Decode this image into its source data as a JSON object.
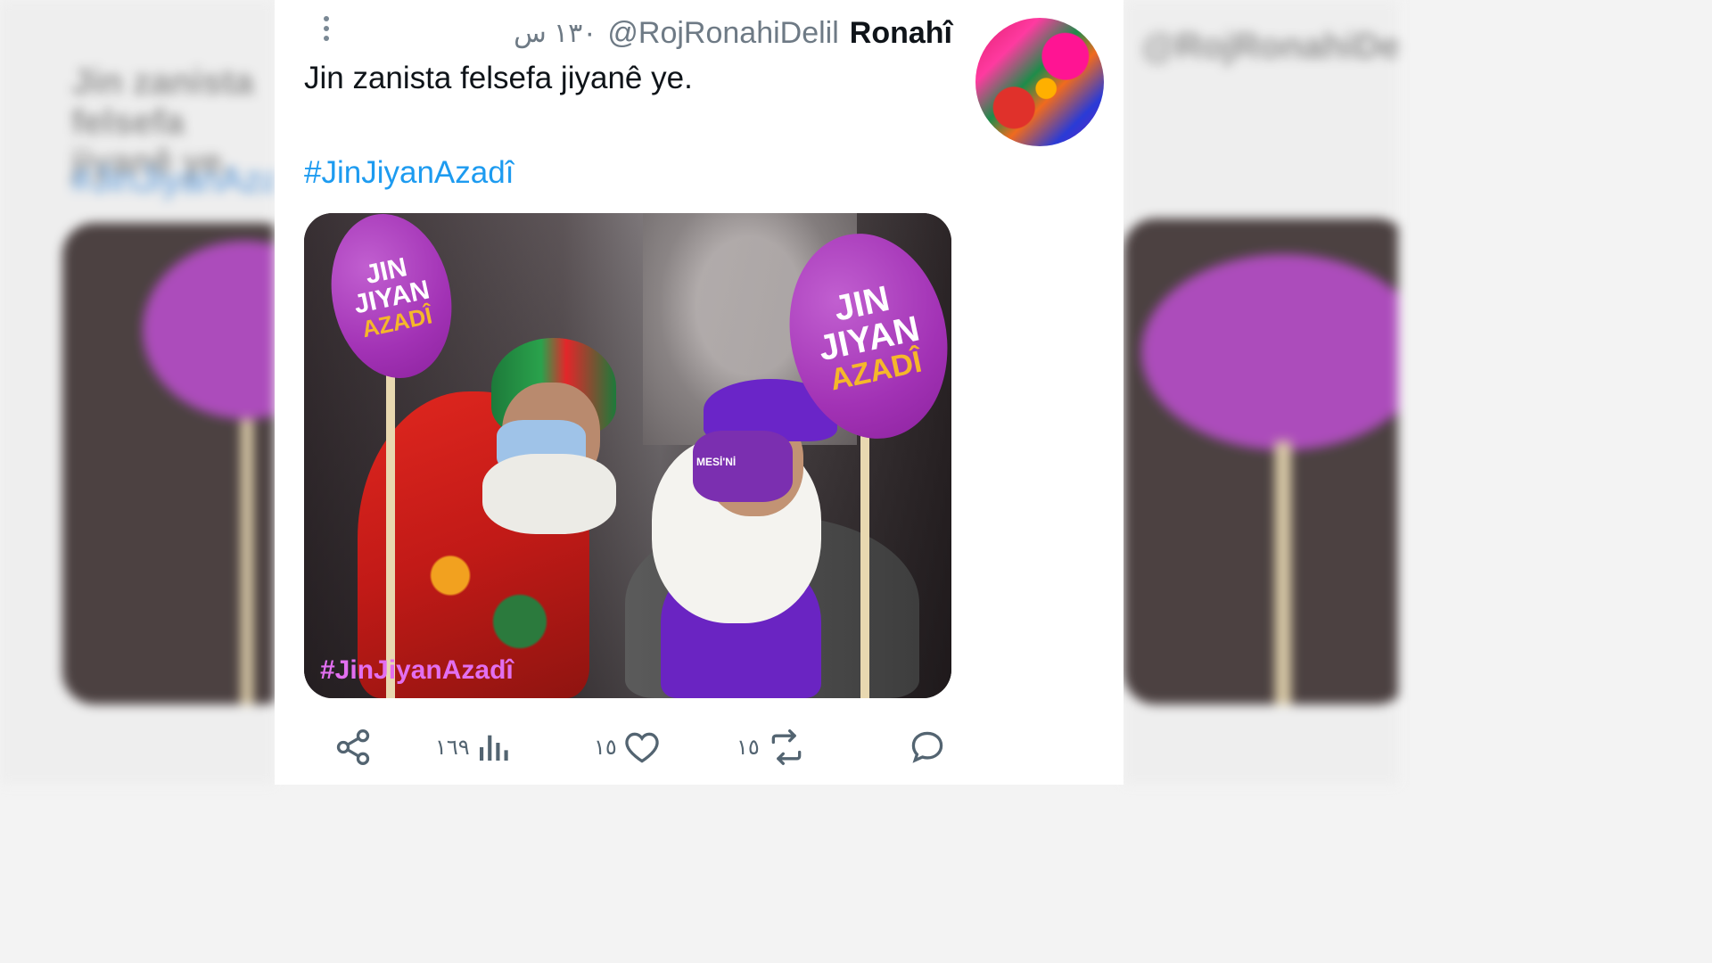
{
  "tweet": {
    "display_name": "Ronahî",
    "handle": "@RojRonahiDelil",
    "time": "١٣٠ س",
    "text": "Jin zanista felsefa jiyanê ye.",
    "hashtag": "#JinJiyanAzadî"
  },
  "media": {
    "sign_text": [
      "JIN",
      "JIYAN",
      "AZADÎ"
    ],
    "mask_text": "MESİ'Nİ",
    "caption": "#JinJiyanAzadî"
  },
  "actions": {
    "views": "١٦٩",
    "likes": "١٥",
    "reposts": "١٥"
  },
  "icons": [
    "more-vertical-icon",
    "share-icon",
    "views-icon",
    "heart-icon",
    "repost-icon",
    "reply-icon"
  ],
  "colors": {
    "link": "#1d9bf0",
    "text": "#0f1419",
    "muted": "#536471",
    "sign_purple": "#a232b5",
    "sign_yellow": "#f5b72a"
  }
}
